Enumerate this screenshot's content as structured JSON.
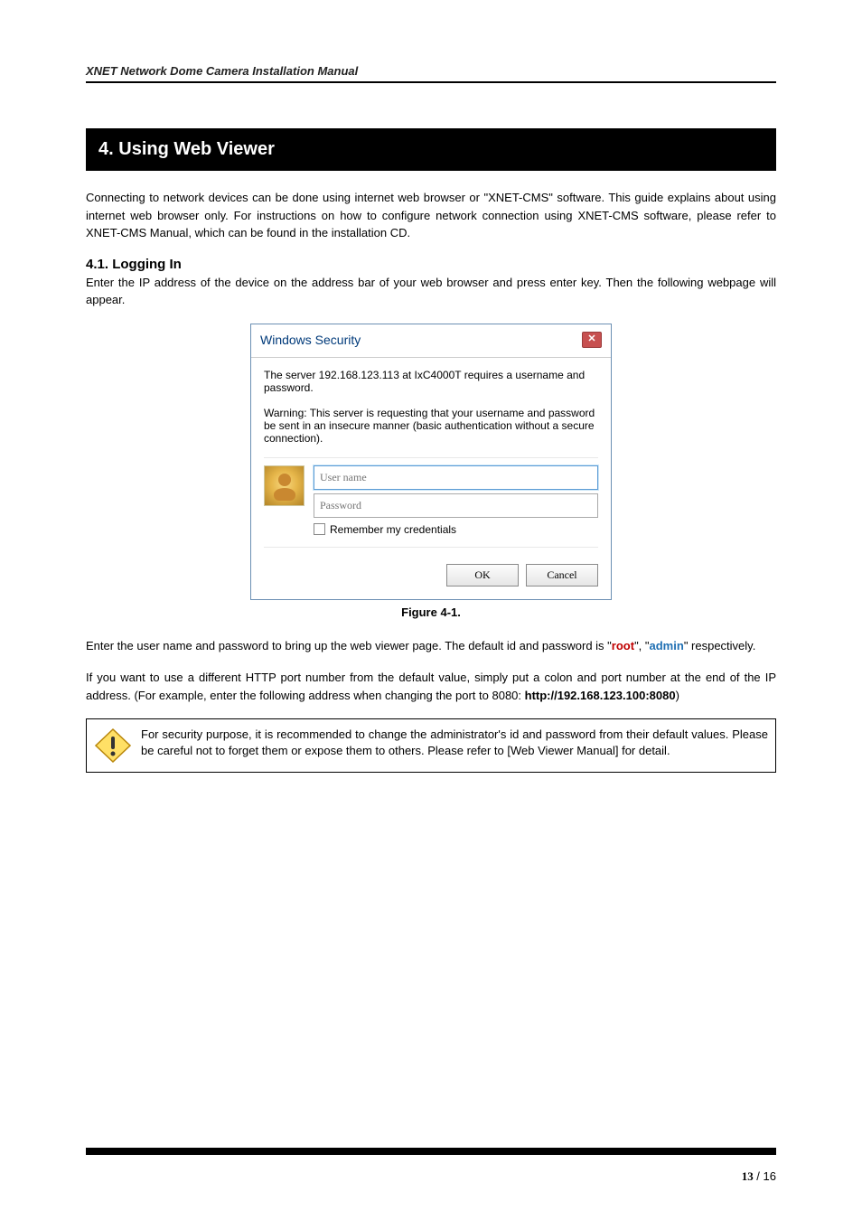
{
  "header": {
    "title": "XNET Network Dome Camera Installation Manual"
  },
  "section": {
    "number": "4.",
    "title": "Using Web Viewer"
  },
  "intro": "Connecting to network devices can be done using internet web browser or \"XNET-CMS\" software. This guide explains about using internet web browser only. For instructions on how to configure network connection using XNET-CMS software, please refer to XNET-CMS Manual, which can be found in the installation CD.",
  "subsection": {
    "number": "4.1.",
    "title": "Logging In",
    "lead": "Enter the IP address of the device on the address bar of your web browser and press enter key. Then the following webpage will appear."
  },
  "dialog": {
    "title": "Windows Security",
    "msg1": "The server 192.168.123.113 at IxC4000T requires a username and password.",
    "msg2": "Warning: This server is requesting that your username and password be sent in an insecure manner (basic authentication without a secure connection).",
    "user_placeholder": "User name",
    "pass_placeholder": "Password",
    "remember_label": "Remember my credentials",
    "ok": "OK",
    "cancel": "Cancel"
  },
  "figure_label": "Figure 4-1.",
  "para2_pre": "Enter the user name and password to bring up the web viewer page. The default id and password is \"",
  "para2_root": "root",
  "para2_mid": "\", \"",
  "para2_admin": "admin",
  "para2_post": "\" respectively.",
  "para3_pre": "If you want to use a different HTTP port number from the default value, simply put a colon and port number at the end of the IP address. (For example, enter the following address when changing the port to 8080: ",
  "para3_url": "http://192.168.123.100:8080",
  "para3_post": ")",
  "note": "For security purpose, it is recommended to change the administrator's id and password from their default values. Please be careful not to forget them or expose them to others. Please refer to [Web Viewer Manual] for detail.",
  "page": {
    "current": "13",
    "sep": " / ",
    "total": "16"
  }
}
